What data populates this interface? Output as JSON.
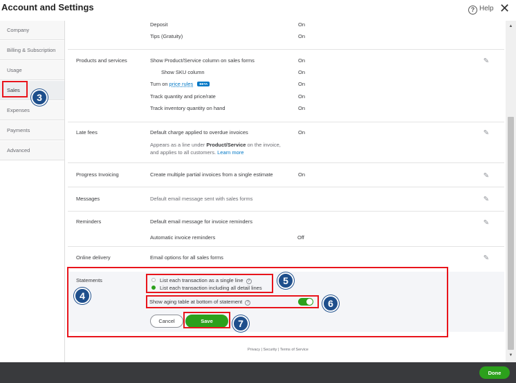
{
  "header": {
    "title": "Account and Settings",
    "help_label": "Help",
    "help_icon": "?",
    "close_icon": "✕"
  },
  "sidebar": {
    "items": [
      {
        "label": "Company"
      },
      {
        "label": "Billing & Subscription"
      },
      {
        "label": "Usage"
      },
      {
        "label": "Sales",
        "active": true
      },
      {
        "label": "Expenses"
      },
      {
        "label": "Payments"
      },
      {
        "label": "Advanced"
      }
    ]
  },
  "sales": {
    "top_rows": [
      {
        "label": "Deposit",
        "value": "On"
      },
      {
        "label": "Tips (Gratuity)",
        "value": "On"
      }
    ],
    "products": {
      "title": "Products and services",
      "rows": [
        {
          "label": "Show Product/Service column on sales forms",
          "value": "On"
        },
        {
          "label": "Show SKU column",
          "value": "On"
        },
        {
          "label_prefix": "Turn on",
          "link": "price rules",
          "badge": "BETA",
          "value": "On"
        },
        {
          "label": "Track quantity and price/rate",
          "value": "On"
        },
        {
          "label": "Track inventory quantity on hand",
          "value": "On"
        }
      ]
    },
    "late_fees": {
      "title": "Late fees",
      "label": "Default charge applied to overdue invoices",
      "value": "On",
      "desc_a": "Appears as a line under ",
      "desc_bold": "Product/Service",
      "desc_b": " on the invoice,",
      "desc_c": "and applies to all customers. ",
      "learn_more": "Learn more"
    },
    "progress": {
      "title": "Progress Invoicing",
      "label": "Create multiple partial invoices from a single estimate",
      "value": "On"
    },
    "messages": {
      "title": "Messages",
      "label": "Default email message sent with sales forms"
    },
    "reminders": {
      "title": "Reminders",
      "label": "Default email message for invoice reminders",
      "auto_label": "Automatic invoice reminders",
      "auto_value": "Off"
    },
    "online_delivery": {
      "title": "Online delivery",
      "label": "Email options for all sales forms"
    },
    "statements": {
      "title": "Statements",
      "option_single": "List each transaction as a single line",
      "option_detail": "List each transaction including all detail lines",
      "selected": "detail",
      "aging_label": "Show aging table at bottom of statement",
      "aging_on": true,
      "cancel_label": "Cancel",
      "save_label": "Save"
    }
  },
  "footer": {
    "privacy": "Privacy",
    "security": "Security",
    "terms": "Terms of Service",
    "divider": "|"
  },
  "done_label": "Done",
  "markers": {
    "m3": "3",
    "m4": "4",
    "m5": "5",
    "m6": "6",
    "m7": "7"
  },
  "colors": {
    "accent_green": "#2ca01c",
    "link_blue": "#0077c5",
    "highlight_red": "#e8141b",
    "marker_blue": "#1e4f8c",
    "bottom_bar": "#393a3d"
  },
  "icons": {
    "pencil": "✎",
    "scroll_up": "▲",
    "scroll_down": "▼",
    "question": "?"
  }
}
